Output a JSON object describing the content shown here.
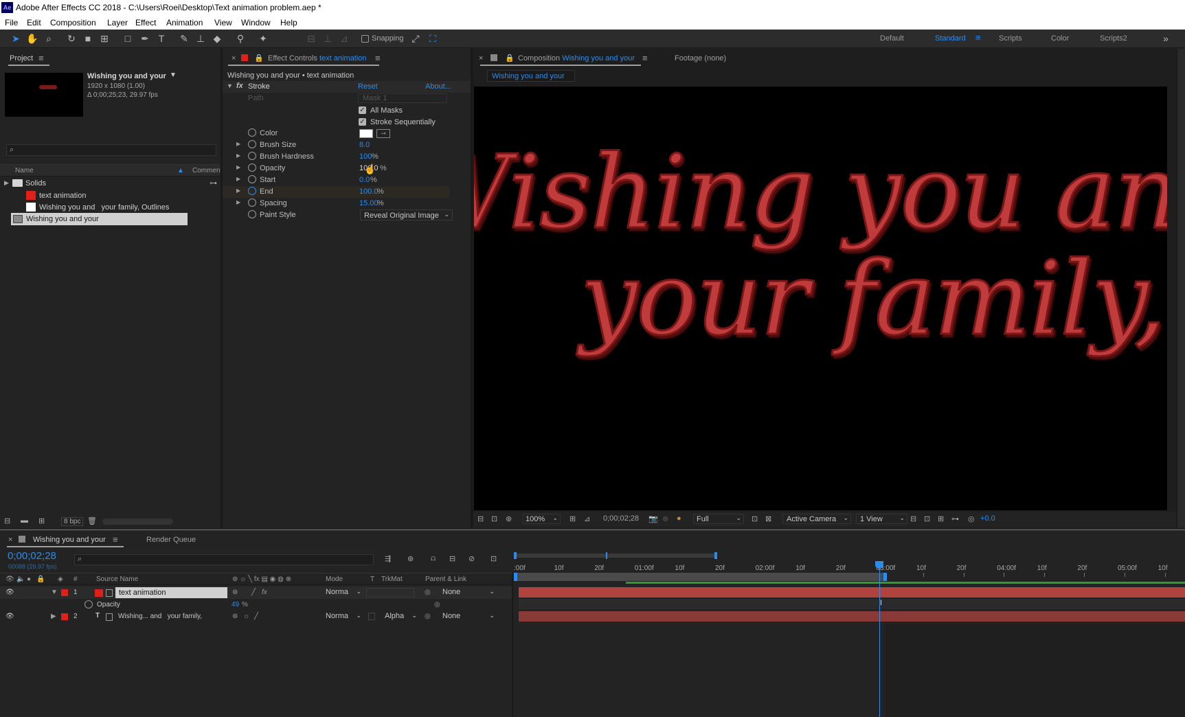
{
  "title_bar": {
    "app_icon": "Ae",
    "title": "Adobe After Effects CC 2018 - C:\\Users\\Roei\\Desktop\\Text animation problem.aep *"
  },
  "menu": [
    "File",
    "Edit",
    "Composition",
    "Layer",
    "Effect",
    "Animation",
    "View",
    "Window",
    "Help"
  ],
  "toolbar": {
    "snapping_label": "Snapping",
    "workspaces": [
      "Default",
      "Standard",
      "Scripts",
      "Color",
      "Scripts2"
    ],
    "active_workspace": "Standard"
  },
  "project": {
    "tab": "Project",
    "comp_name": "Wishing you and your",
    "comp_res": "1920 x 1080 (1.00)",
    "comp_dur": "Δ 0;00;25;23, 29.97 fps",
    "search_placeholder": "",
    "col_name": "Name",
    "col_comment": "Comment",
    "items": [
      {
        "name": "Solids",
        "type": "folder"
      },
      {
        "name": "text animation",
        "type": "solid",
        "color": "#e0201b"
      },
      {
        "name": "Wishing you and   your family, Outlines",
        "type": "solid",
        "color": "#ffffff"
      },
      {
        "name": "Wishing you and your",
        "type": "comp",
        "selected": true
      }
    ],
    "bpc": "8 bpc"
  },
  "effect_controls": {
    "tab_prefix": "Effect Controls",
    "tab_layer": "text animation",
    "breadcrumb": "Wishing you and your • text animation",
    "effect_name": "Stroke",
    "reset": "Reset",
    "about": "About...",
    "path_label": "Path",
    "path_value": "Mask 1",
    "all_masks": "All Masks",
    "stroke_seq": "Stroke Sequentially",
    "props": [
      {
        "name": "Color",
        "value": "",
        "unit": ""
      },
      {
        "name": "Brush Size",
        "value": "8.0",
        "unit": ""
      },
      {
        "name": "Brush Hardness",
        "value": "100",
        "unit": "%"
      },
      {
        "name": "Opacity",
        "value": "100.0",
        "unit": "%"
      },
      {
        "name": "Start",
        "value": "0.0",
        "unit": "%"
      },
      {
        "name": "End",
        "value": "100.0",
        "unit": "%"
      },
      {
        "name": "Spacing",
        "value": "15.00",
        "unit": "%"
      },
      {
        "name": "Paint Style",
        "value": "Reveal Original Image",
        "unit": ""
      }
    ]
  },
  "composition": {
    "tab_prefix": "Composition",
    "tab_name": "Wishing you and your",
    "footage_tab": "Footage (none)",
    "sub_tab": "Wishing you and your",
    "text_line1": "Wishing you and",
    "text_line2": "your family,",
    "text_color": "#c03a3a",
    "zoom": "100%",
    "timecode": "0;00;02;28",
    "resolution": "Full",
    "camera": "Active Camera",
    "view": "1 View",
    "exposure": "+0.0"
  },
  "timeline": {
    "tab": "Wishing you and your",
    "render_queue": "Render Queue",
    "current_time": "0;00;02;28",
    "frame_info": "00088 (29.97 fps)",
    "cols": {
      "source": "Source Name",
      "mode": "Mode",
      "t": "T",
      "trkmat": "TrkMat",
      "parent": "Parent & Link"
    },
    "ruler": [
      ":00f",
      "10f",
      "20f",
      "01:00f",
      "10f",
      "20f",
      "02:00f",
      "10f",
      "20f",
      "03:00f",
      "10f",
      "20f",
      "04:00f",
      "10f",
      "20f",
      "05:00f",
      "10f"
    ],
    "layers": [
      {
        "num": "1",
        "name": "text animation",
        "mode": "Norma",
        "trkmat": "",
        "parent": "None",
        "color": "#e0201b"
      },
      {
        "num": "2",
        "name": "Wishing... and   your family,",
        "mode": "Norma",
        "trkmat": "Alpha",
        "parent": "None",
        "color": "#e0201b"
      }
    ],
    "sub_prop": {
      "name": "Opacity",
      "value": "49",
      "unit": "%"
    }
  }
}
